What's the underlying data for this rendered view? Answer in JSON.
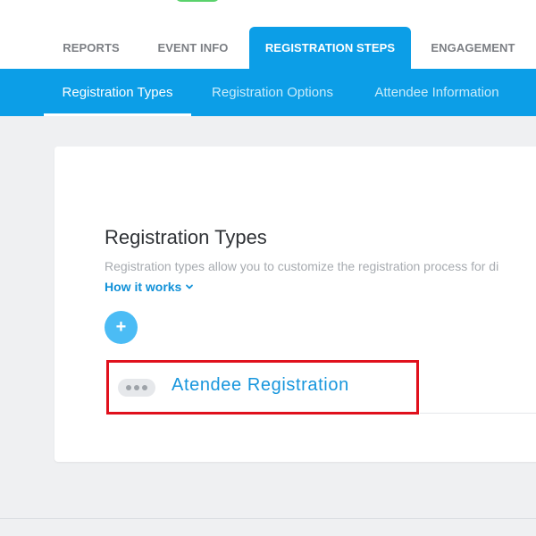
{
  "nav": {
    "tabs": [
      {
        "label": "REPORTS"
      },
      {
        "label": "EVENT INFO"
      },
      {
        "label": "REGISTRATION STEPS"
      },
      {
        "label": "ENGAGEMENT"
      }
    ],
    "active_tab": "REGISTRATION STEPS"
  },
  "subnav": {
    "tabs": [
      {
        "label": "Registration Types"
      },
      {
        "label": "Registration Options"
      },
      {
        "label": "Attendee Information"
      }
    ],
    "active_tab": "Registration Types"
  },
  "section": {
    "title": "Registration Types",
    "description": "Registration types allow you to customize the registration process for di",
    "how_it_works": "How it works",
    "add_button": "+"
  },
  "registration_types": [
    {
      "name": "Atendee Registration",
      "menu_icon": "more-dots-icon"
    }
  ],
  "colors": {
    "accent": "#0c9ee7",
    "link": "#1191d8",
    "add_button": "#4bbcf5",
    "highlight_border": "#e0101c"
  }
}
